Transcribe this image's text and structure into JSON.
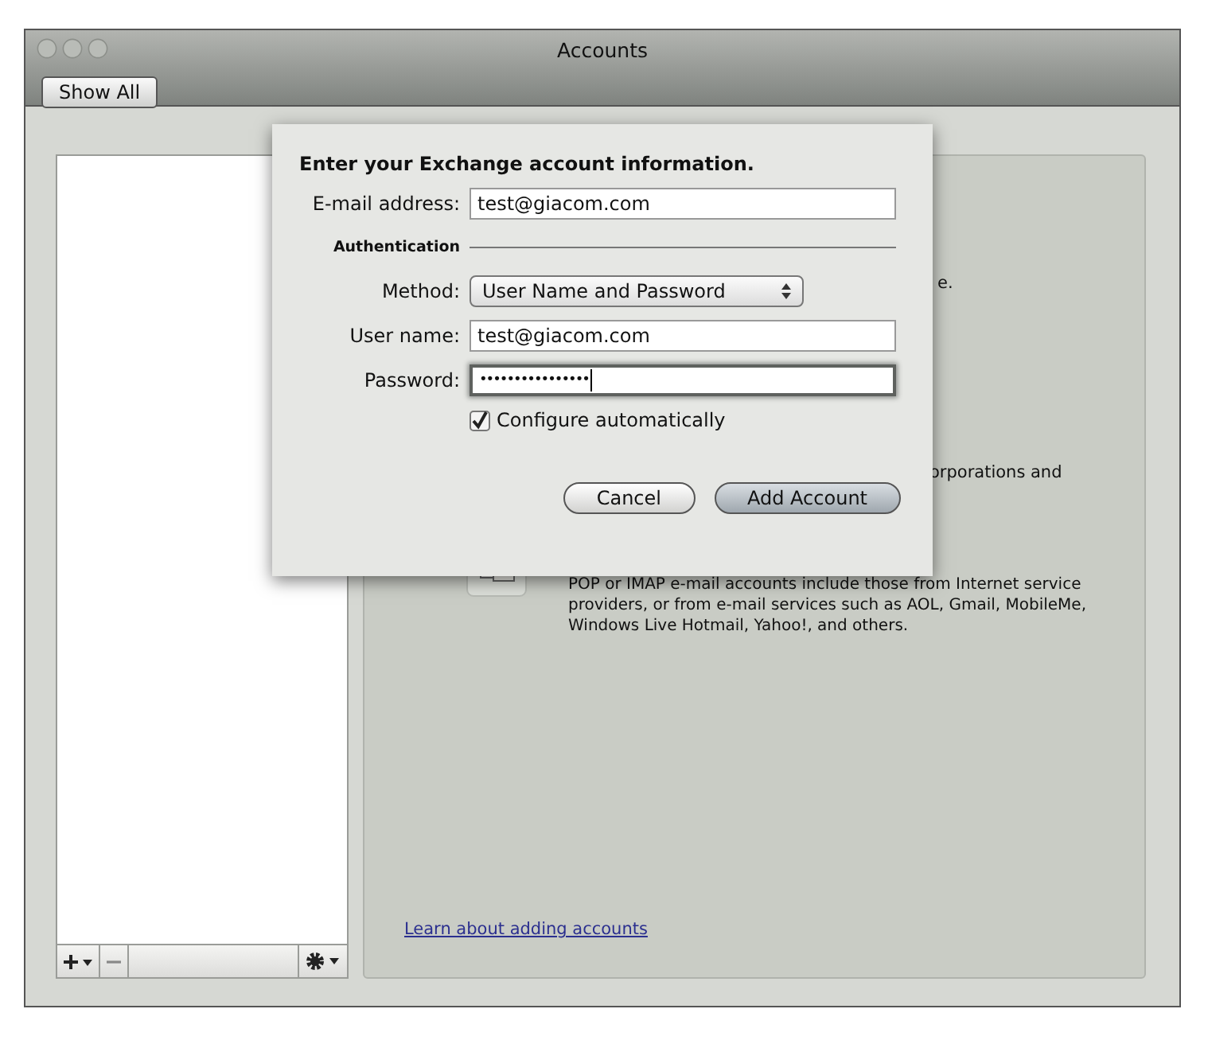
{
  "window": {
    "title": "Accounts"
  },
  "toolbar": {
    "show_all": "Show All"
  },
  "panel": {
    "fragments": [
      "e.",
      "orporations and"
    ],
    "email_account_description": "POP or IMAP e-mail accounts include those from Internet service providers, or from e-mail services such as AOL, Gmail, MobileMe, Windows Live Hotmail, Yahoo!, and others.",
    "link": "Learn about adding accounts"
  },
  "sheet": {
    "heading": "Enter your Exchange account information.",
    "fields": [
      {
        "kind": "text",
        "label": "E-mail address:",
        "value": "test@giacom.com",
        "focused": false
      },
      {
        "kind": "section",
        "label": "Authentication"
      },
      {
        "kind": "popup",
        "label": "Method:",
        "value": "User Name and Password",
        "focused": false
      },
      {
        "kind": "text",
        "label": "User name:",
        "value": "test@giacom.com",
        "focused": false
      },
      {
        "kind": "password",
        "label": "Password:",
        "value": "••••••••••••••••",
        "focused": true
      }
    ],
    "checkbox": {
      "label": "Configure automatically",
      "checked": true
    },
    "buttons": [
      {
        "label": "Cancel",
        "default": false
      },
      {
        "label": "Add Account",
        "default": true
      }
    ]
  }
}
